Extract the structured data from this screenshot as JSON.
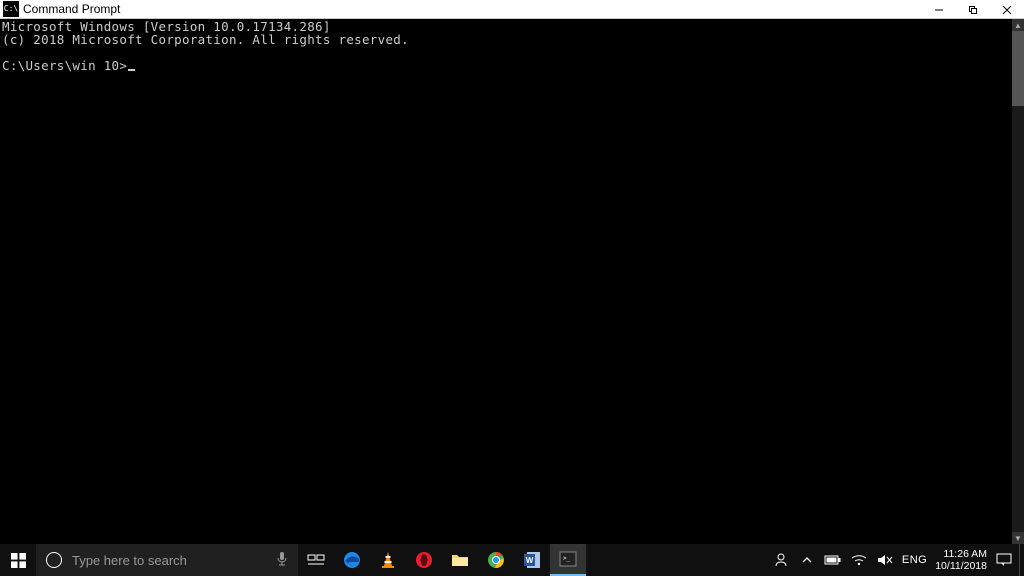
{
  "window": {
    "title": "Command Prompt",
    "icon_name": "cmd-icon"
  },
  "terminal": {
    "line1": "Microsoft Windows [Version 10.0.17134.286]",
    "line2": "(c) 2018 Microsoft Corporation. All rights reserved.",
    "prompt": "C:\\Users\\win 10>"
  },
  "taskbar": {
    "search_placeholder": "Type here to search",
    "lang": "ENG",
    "time": "11:26 AM",
    "date": "10/11/2018"
  }
}
